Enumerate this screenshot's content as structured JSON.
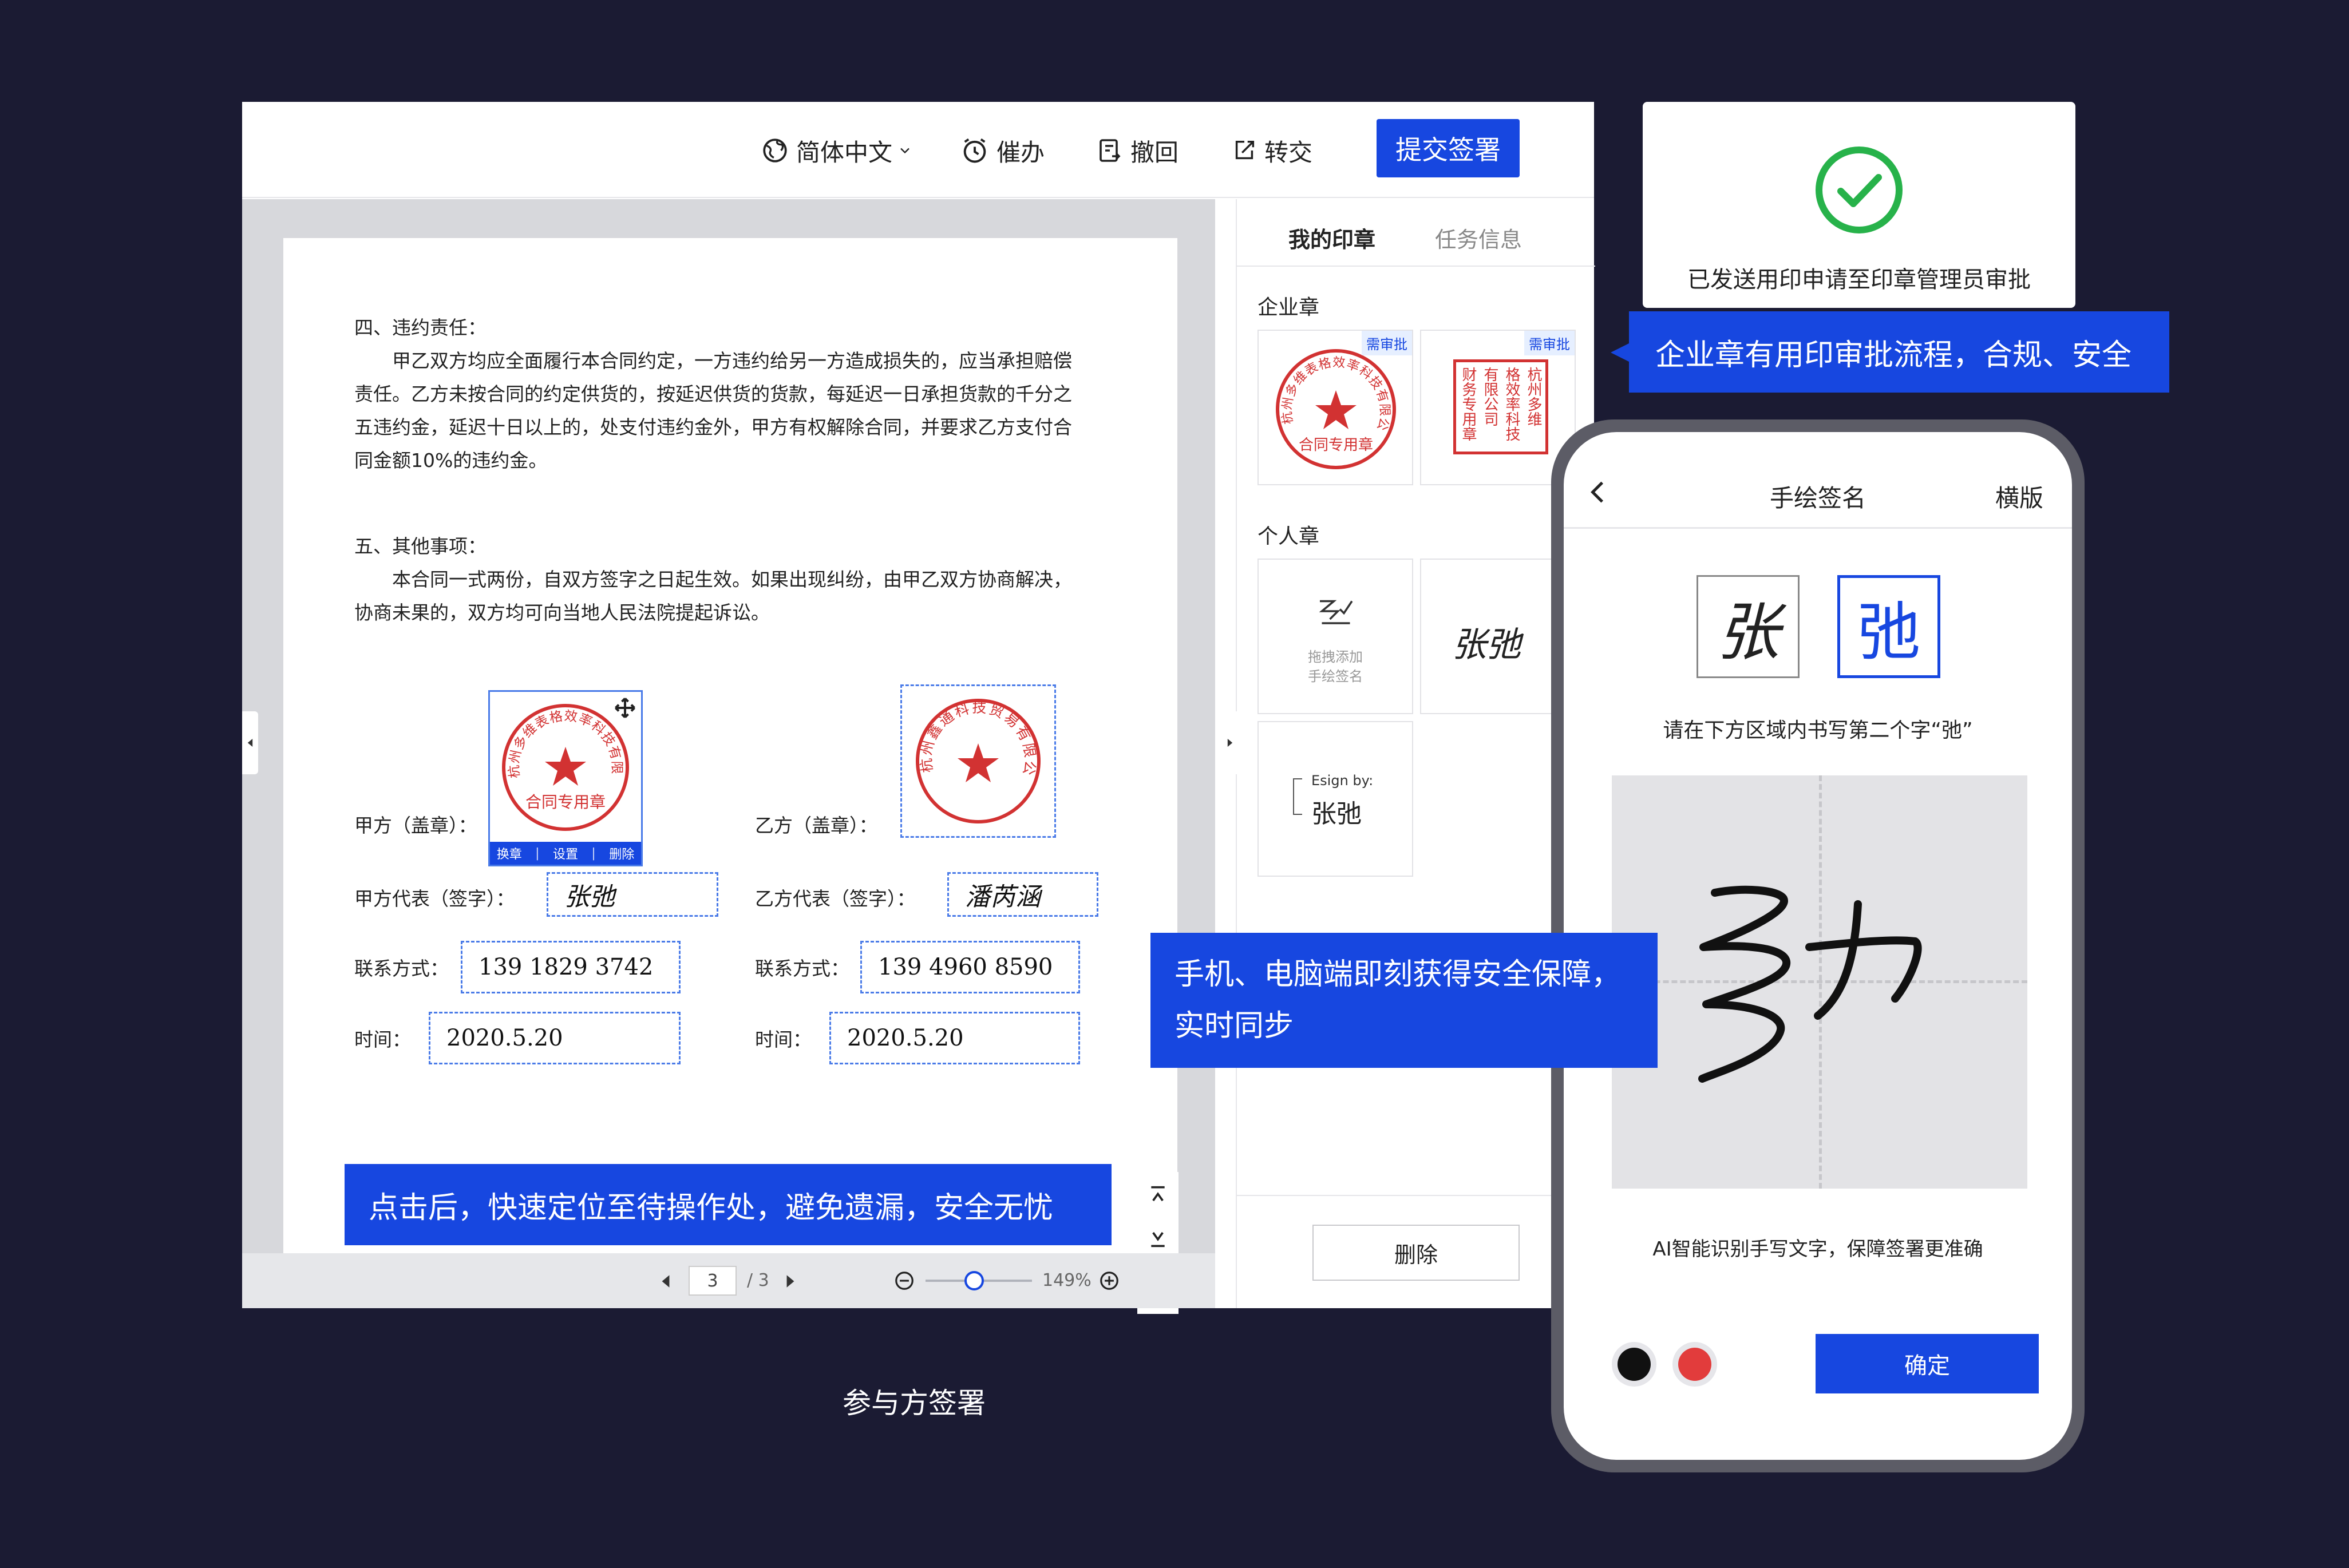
{
  "toolbar": {
    "language": "简体中文",
    "remind": "催办",
    "withdraw": "撤回",
    "transfer": "转交",
    "submit": "提交签署"
  },
  "document": {
    "sec4_title": "四、违约责任：",
    "sec4_lines": [
      "甲乙双方均应全面履行本合同约定，一方违约给另一方造成损失的，应当承担赔偿",
      "责任。乙方未按合同的约定供货的，按延迟供货的货款，每延迟一日承担货款的千分之",
      "五违约金，延迟十日以上的，处支付违约金外，甲方有权解除合同，并要求乙方支付合",
      "同金额10%的违约金。"
    ],
    "sec5_title": "五、其他事项：",
    "sec5_lines": [
      "本合同一式两份，自双方签字之日起生效。如果出现纠纷，由甲乙双方协商解决，",
      "协商未果的，双方均可向当地人民法院提起诉讼。"
    ],
    "party_a": {
      "seal_label": "甲方（盖章）：",
      "rep_label": "甲方代表（签字）：",
      "signature": "张弛",
      "contact_label": "联系方式：",
      "phone": "139 1829 3742",
      "time_label": "时间：",
      "date": "2020.5.20",
      "seal_text": "合同专用章",
      "seal_ring": "杭州多维表格效率科技有限公司",
      "seal_actions": [
        "换章",
        "设置",
        "删除"
      ]
    },
    "party_b": {
      "seal_label": "乙方（盖章）：",
      "rep_label": "乙方代表（签字）：",
      "signature": "潘芮涵",
      "contact_label": "联系方式：",
      "phone": "139 4960 8590",
      "time_label": "时间：",
      "date": "2020.5.20",
      "seal_ring": "杭州鑫通科技贸易有限公司"
    }
  },
  "pager": {
    "current": "3",
    "total": "/ 3",
    "zoom": "149%"
  },
  "sidepanel": {
    "tab_seals": "我的印章",
    "tab_info": "任务信息",
    "corp_section": "企业章",
    "badge": "需审批",
    "corp_seal1_text": "合同专用章",
    "corp_seal1_ring": "杭州多维表格效率科技有限公司",
    "corp_seal2_cols": [
      "杭州多维",
      "格效率科技",
      "有限公司",
      "财务专用章"
    ],
    "personal_section": "个人章",
    "add_hand_sign": [
      "拖拽添加",
      "手绘签名"
    ],
    "personal_sig": "张弛",
    "esign_by": "Esign by:",
    "esign_name": "张弛",
    "delete": "删除"
  },
  "callouts": {
    "approval_flow": "企业章有用印审批流程，合规、安全",
    "sync": [
      "手机、电脑端即刻获得安全保障，",
      "实时同步"
    ],
    "locate": "点击后，快速定位至待操作处，避免遗漏，安全无忧"
  },
  "approved": {
    "text": "已发送用印申请至印章管理员审批",
    "accent": "#27b24a"
  },
  "phone": {
    "title": "手绘签名",
    "landscape": "横版",
    "char1": "张",
    "char2": "弛",
    "instruction": "请在下方区域内书写第二个字“弛”",
    "ai_note": "AI智能识别手写文字，保障签署更准确",
    "confirm": "确定",
    "colors": [
      "#111111",
      "#e23c3c"
    ]
  },
  "caption": "参与方签署",
  "colors": {
    "brand": "#1747e0",
    "background": "#1b1b33",
    "seal": "#d23232"
  }
}
